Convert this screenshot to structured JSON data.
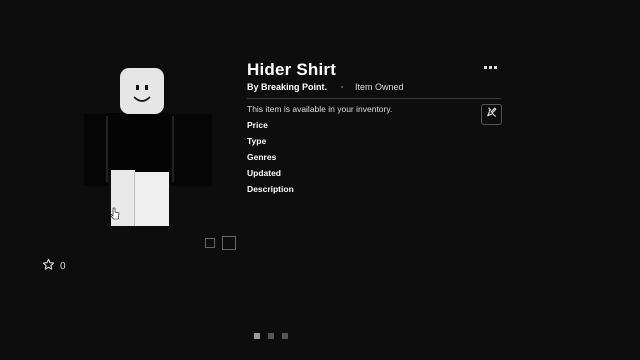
{
  "item": {
    "title": "Hider Shirt",
    "creator": "By Breaking Point.",
    "ownership": "Item Owned",
    "availability": "This item is available in your inventory."
  },
  "fields": {
    "price": "Price",
    "type": "Type",
    "genres": "Genres",
    "updated": "Updated",
    "description": "Description"
  },
  "favorites": {
    "count": "0"
  },
  "pager": {
    "pages": 3,
    "active": 1
  },
  "colors": {
    "background": "#0d0d0d",
    "text": "#ffffff",
    "divider": "#3a3a3a",
    "avatar_head": "#e6e6e6",
    "shirt": "#050505",
    "pants": "#ececec"
  },
  "icons": [
    "more-icon",
    "edit-avatar-icon",
    "star-icon",
    "cursor-icon",
    "view-2d-icon",
    "view-3d-icon"
  ]
}
